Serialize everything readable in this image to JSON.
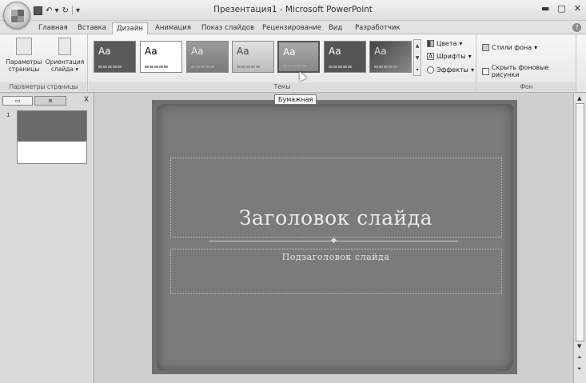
{
  "titlebar": {
    "title": "Презентация1 - Microsoft PowerPoint",
    "minimize": "▬",
    "maximize": "□",
    "close": "✕"
  },
  "tabs": [
    "Главная",
    "Вставка",
    "Дизайн",
    "Анимация",
    "Показ слайдов",
    "Рецензирование",
    "Вид",
    "Разработчик"
  ],
  "active_tab": "Дизайн",
  "ribbon": {
    "page_setup_group": {
      "label": "Параметры страницы",
      "page_setup_button": "Параметры страницы",
      "orientation_button": "Ориентация слайда"
    },
    "themes_group": {
      "label": "Темы",
      "theme_sample_text": "Aa",
      "colors_button": "Цвета",
      "fonts_button": "Шрифты",
      "effects_button": "Эффекты"
    },
    "background_group": {
      "label": "Фон",
      "background_styles_button": "Стили фона",
      "hide_background_checkbox": "Скрыть фоновые рисунки"
    }
  },
  "tooltip": "Бумажная",
  "slide": {
    "title": "Заголовок слайда",
    "subtitle": "Подзаголовок слайда"
  },
  "thumbnail_number": "1",
  "pane_close": "X",
  "colors": {
    "slide_bg": "#7b7b7b",
    "ribbon_bg": "#efefef"
  }
}
